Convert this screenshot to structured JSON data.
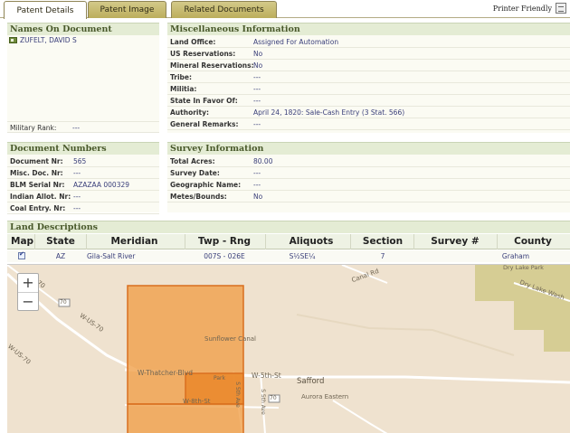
{
  "tabs": [
    {
      "label": "Patent Details"
    },
    {
      "label": "Patent Image"
    },
    {
      "label": "Related Documents"
    }
  ],
  "printer_friendly": "Printer Friendly",
  "names": {
    "title": "Names On Document",
    "name": "ZUFELT, DAVID S",
    "military_rank_label": "Military Rank:",
    "military_rank_value": "---"
  },
  "misc": {
    "title": "Miscellaneous Information",
    "rows": [
      {
        "label": "Land Office:",
        "value": "Assigned For Automation"
      },
      {
        "label": "US Reservations:",
        "value": "No"
      },
      {
        "label": "Mineral Reservations:",
        "value": "No"
      },
      {
        "label": "Tribe:",
        "value": "---"
      },
      {
        "label": "Militia:",
        "value": "---"
      },
      {
        "label": "State In Favor Of:",
        "value": "---"
      },
      {
        "label": "Authority:",
        "value": "April 24, 1820: Sale-Cash Entry (3 Stat. 566)"
      },
      {
        "label": "General Remarks:",
        "value": "---"
      }
    ]
  },
  "docnums": {
    "title": "Document Numbers",
    "rows": [
      {
        "label": "Document Nr:",
        "value": "565"
      },
      {
        "label": "Misc. Doc. Nr:",
        "value": "---"
      },
      {
        "label": "BLM Serial Nr:",
        "value": "AZAZAA 000329"
      },
      {
        "label": "Indian Allot. Nr:",
        "value": "---"
      },
      {
        "label": "Coal Entry. Nr:",
        "value": "---"
      }
    ]
  },
  "survey": {
    "title": "Survey Information",
    "rows": [
      {
        "label": "Total Acres:",
        "value": "80.00"
      },
      {
        "label": "Survey Date:",
        "value": "---"
      },
      {
        "label": "Geographic Name:",
        "value": "---"
      },
      {
        "label": "Metes/Bounds:",
        "value": "No"
      }
    ]
  },
  "land": {
    "title": "Land Descriptions",
    "columns": [
      "Map",
      "State",
      "Meridian",
      "Twp - Rng",
      "Aliquots",
      "Section",
      "Survey #",
      "County"
    ],
    "row": {
      "map_checked": true,
      "state": "AZ",
      "meridian": "Gila-Salt River",
      "twp_rng": "007S - 026E",
      "aliquots": "S½SE¼",
      "section": "7",
      "survey": "",
      "county": "Graham"
    }
  },
  "map": {
    "zoom_in": "+",
    "zoom_out": "−",
    "labels": {
      "us70_a": "US-70",
      "us70_b": "W-US-70",
      "us70_c": "W-US-70",
      "canal_rd": "Canal Rd",
      "dry_lake_park": "Dry Lake Park",
      "dry_lake_wash": "Dry Lake Wash",
      "sunflower_canal": "Sunflower Canal",
      "thatcher_blvd": "W-Thatcher-Blvd",
      "w5th": "W-5th-St",
      "safford": "Safford",
      "aurora_eastern": "Aurora Eastern",
      "w8th": "W-8th-St",
      "park": "Park",
      "s5th_ave_a": "S 5th Ave",
      "s5th_ave_b": "S 5th Ave",
      "hw_a": "70",
      "hw_b": "70"
    },
    "colors": {
      "base": "#efe2cf",
      "parcel_fill": "#f0a04a",
      "parcel_stroke": "#d96e1e",
      "green_area": "#d6cd94",
      "road": "#ffffff"
    }
  }
}
